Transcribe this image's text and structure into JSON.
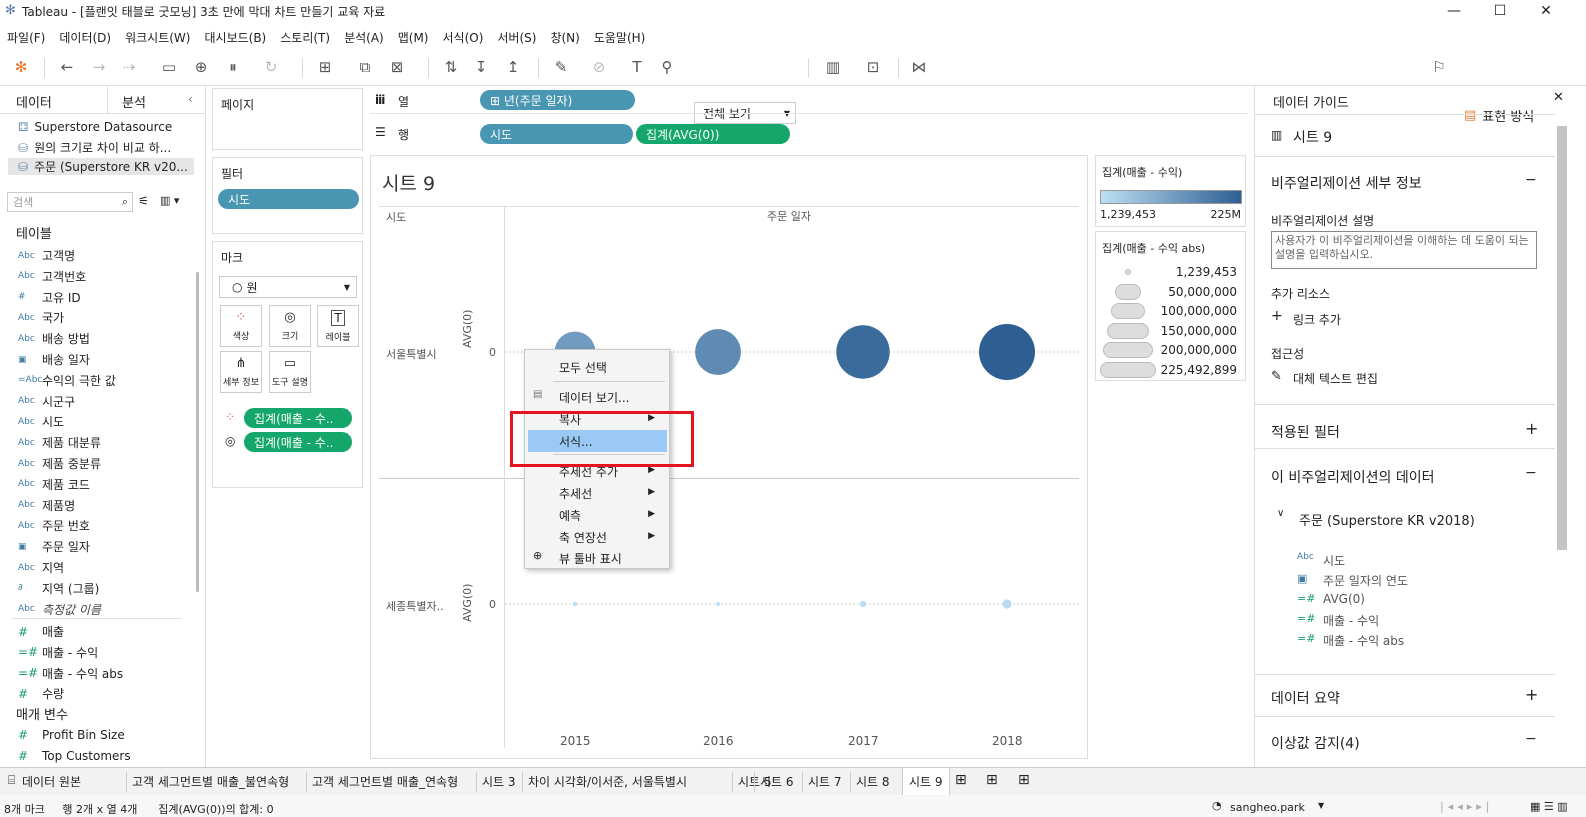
{
  "window": {
    "title": "Tableau - [플랜잇 태블로 굿모닝] 3초 만에 막대 차트 만들기 교육 자료"
  },
  "menu": [
    "파일(F)",
    "데이터(D)",
    "워크시트(W)",
    "대시보드(B)",
    "스토리(T)",
    "분석(A)",
    "맵(M)",
    "서식(O)",
    "서버(S)",
    "창(N)",
    "도움말(H)"
  ],
  "toolbar": {
    "fit_select": "전체 보기",
    "show_me": "표현 방식"
  },
  "left": {
    "tab_data": "데이터",
    "tab_analysis": "분석",
    "datasources": [
      "Superstore Datasource",
      "원의 크기로 차이 비교 하...",
      "주문 (Superstore KR v20..."
    ],
    "search_placeholder": "검색",
    "tables_header": "테이블",
    "dimensions": [
      {
        "icon": "Abc",
        "name": "고객명"
      },
      {
        "icon": "Abc",
        "name": "고객번호"
      },
      {
        "icon": "#",
        "name": "고유 ID"
      },
      {
        "icon": "Abc",
        "name": "국가"
      },
      {
        "icon": "Abc",
        "name": "배송 방법"
      },
      {
        "icon": "date",
        "name": "배송 일자"
      },
      {
        "icon": "=Abc",
        "name": "수익의 극한 값"
      },
      {
        "icon": "Abc",
        "name": "시군구"
      },
      {
        "icon": "Abc",
        "name": "시도"
      },
      {
        "icon": "Abc",
        "name": "제품 대분류"
      },
      {
        "icon": "Abc",
        "name": "제품 중분류"
      },
      {
        "icon": "Abc",
        "name": "제품 코드"
      },
      {
        "icon": "Abc",
        "name": "제품명"
      },
      {
        "icon": "Abc",
        "name": "주문 번호"
      },
      {
        "icon": "date",
        "name": "주문 일자"
      },
      {
        "icon": "Abc",
        "name": "지역"
      },
      {
        "icon": "clip",
        "name": "지역 (그룹)"
      },
      {
        "icon": "Abc",
        "name": "측정값 이름"
      }
    ],
    "measures": [
      {
        "icon": "#",
        "name": "매출"
      },
      {
        "icon": "=#",
        "name": "매출 - 수익"
      },
      {
        "icon": "=#",
        "name": "매출 - 수익 abs"
      },
      {
        "icon": "#",
        "name": "수량"
      }
    ],
    "params_header": "매개 변수",
    "params": [
      "Profit Bin Size",
      "Top Customers"
    ]
  },
  "shelves": {
    "pages": "페이지",
    "filters": "필터",
    "filter_pill": "시도",
    "marks": "마크",
    "mark_type": "원",
    "mark_buttons": [
      "색상",
      "크기",
      "레이블",
      "세부 정보",
      "도구 설명"
    ],
    "mark_pills": [
      "집계(매출 - 수..",
      "집계(매출 - 수.."
    ],
    "columns_label": "열",
    "rows_label": "행",
    "columns_pill": "⊞ 년(주문 일자)",
    "rows_pills": [
      "시도",
      "집계(AVG(0))"
    ]
  },
  "viz": {
    "sheet_title": "시트 9",
    "row_header": "시도",
    "col_header": "주문 일자",
    "rows": [
      "서울특별시",
      "세종특별자.."
    ],
    "axis_label": "AVG(0)",
    "axis_tick": "0"
  },
  "chart_data": {
    "type": "scatter",
    "title": "시트 9",
    "xlabel": "주문 일자",
    "categories": [
      "2015",
      "2016",
      "2017",
      "2018"
    ],
    "series": [
      {
        "name": "서울특별시",
        "values": [
          0,
          0,
          0,
          0
        ],
        "size": [
          120000000,
          150000000,
          205000000,
          225492899
        ]
      },
      {
        "name": "세종특별자..",
        "values": [
          0,
          0,
          0,
          0
        ],
        "size": [
          1500000,
          1239453,
          3000000,
          6000000
        ]
      }
    ]
  },
  "context_menu": {
    "items": [
      "모두 선택",
      "데이터 보기...",
      "복사",
      "서식...",
      "추세선 추가",
      "추세선",
      "예측",
      "축 연장선",
      "뷰 툴바 표시"
    ],
    "highlighted": "서식..."
  },
  "legends": {
    "color_title": "집계(매출 - 수익)",
    "color_min": "1,239,453",
    "color_max": "225M",
    "size_title": "집계(매출 - 수익 abs)",
    "size_values": [
      "1,239,453",
      "50,000,000",
      "100,000,000",
      "150,000,000",
      "200,000,000",
      "225,492,899"
    ]
  },
  "guide": {
    "header": "데이터 가이드",
    "sheet": "시트 9",
    "viz_details": "비주얼리제이션 세부 정보",
    "desc_label": "비주얼리제이션 설명",
    "desc_placeholder": "사용자가 이 비주얼리제이션을 이해하는 데 도움이 되는 설명을 입력하십시오.",
    "extra_resources": "추가 리소스",
    "add_link": "링크 추가",
    "accessibility": "접근성",
    "alt_text": "대체 텍스트 편집",
    "applied_filters": "적용된 필터",
    "viz_data": "이 비주얼리제이션의 데이터",
    "datasource": "주문 (Superstore KR v2018)",
    "fields": [
      {
        "icon": "Abc",
        "name": "시도"
      },
      {
        "icon": "date",
        "name": "주문 일자의 연도"
      },
      {
        "icon": "=#",
        "name": "AVG(0)"
      },
      {
        "icon": "=#",
        "name": "매출 - 수익"
      },
      {
        "icon": "=#",
        "name": "매출 - 수익 abs"
      }
    ],
    "data_summary": "데이터 요약",
    "outliers": "이상값 감지(4)"
  },
  "bottom_tabs": [
    "데이터 원본",
    "고객 세그먼트별 매출_불연속형",
    "고객 세그먼트별 매출_연속형",
    "시트 3",
    "차이 시각화/이서준, 서울특별시",
    "시트 5",
    "시트 6",
    "시트 7",
    "시트 8",
    "시트 9"
  ],
  "status": {
    "left": "8개 마크     행 2개 x 열 4개      집계(AVG(0))의 합계: 0",
    "user": "sangheo.park"
  },
  "colors": {
    "dim_pill": "#4996b2",
    "measure_pill": "#14a66a",
    "highlight": "#99c9f4",
    "callout": "#e6141e"
  }
}
